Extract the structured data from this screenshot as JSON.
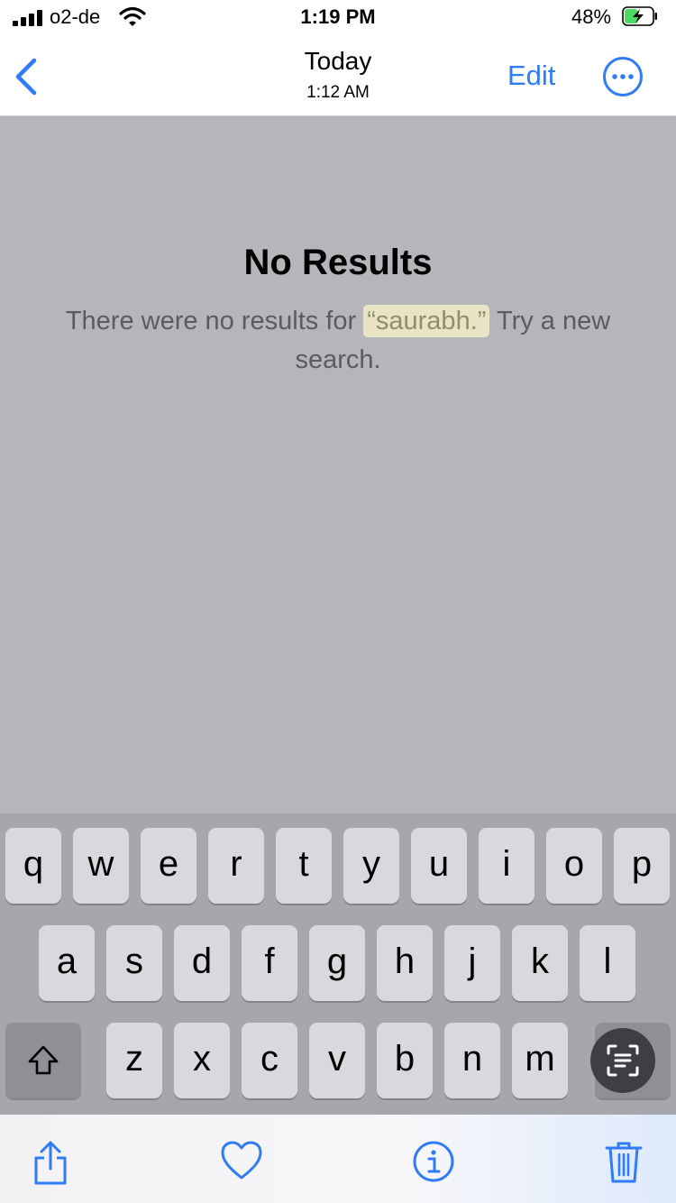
{
  "status_bar": {
    "carrier": "o2-de",
    "time": "1:19 PM",
    "battery_percent": "48%",
    "battery_level": 0.48
  },
  "nav": {
    "title": "Today",
    "subtitle": "1:12 AM",
    "edit_label": "Edit",
    "back_icon": "chevron-left-icon",
    "more_icon": "ellipsis-circle-icon"
  },
  "main": {
    "title": "No Results",
    "message_prefix": "There were no results for ",
    "query": "“saurabh.”",
    "message_suffix": " Try a new search."
  },
  "keyboard": {
    "row1": [
      "q",
      "w",
      "e",
      "r",
      "t",
      "y",
      "u",
      "i",
      "o",
      "p"
    ],
    "row2": [
      "a",
      "s",
      "d",
      "f",
      "g",
      "h",
      "j",
      "k",
      "l"
    ],
    "row3": [
      "z",
      "x",
      "c",
      "v",
      "b",
      "n",
      "m"
    ],
    "shift_icon": "shift-icon",
    "scan_icon": "text-scan-icon"
  },
  "toolbar": {
    "share_icon": "share-icon",
    "favorite_icon": "heart-icon",
    "info_icon": "info-icon",
    "delete_icon": "trash-icon"
  },
  "colors": {
    "accent": "#2f7cf6",
    "dimmed_background": "#b6b6ba",
    "query_highlight": "#eae4c6"
  }
}
